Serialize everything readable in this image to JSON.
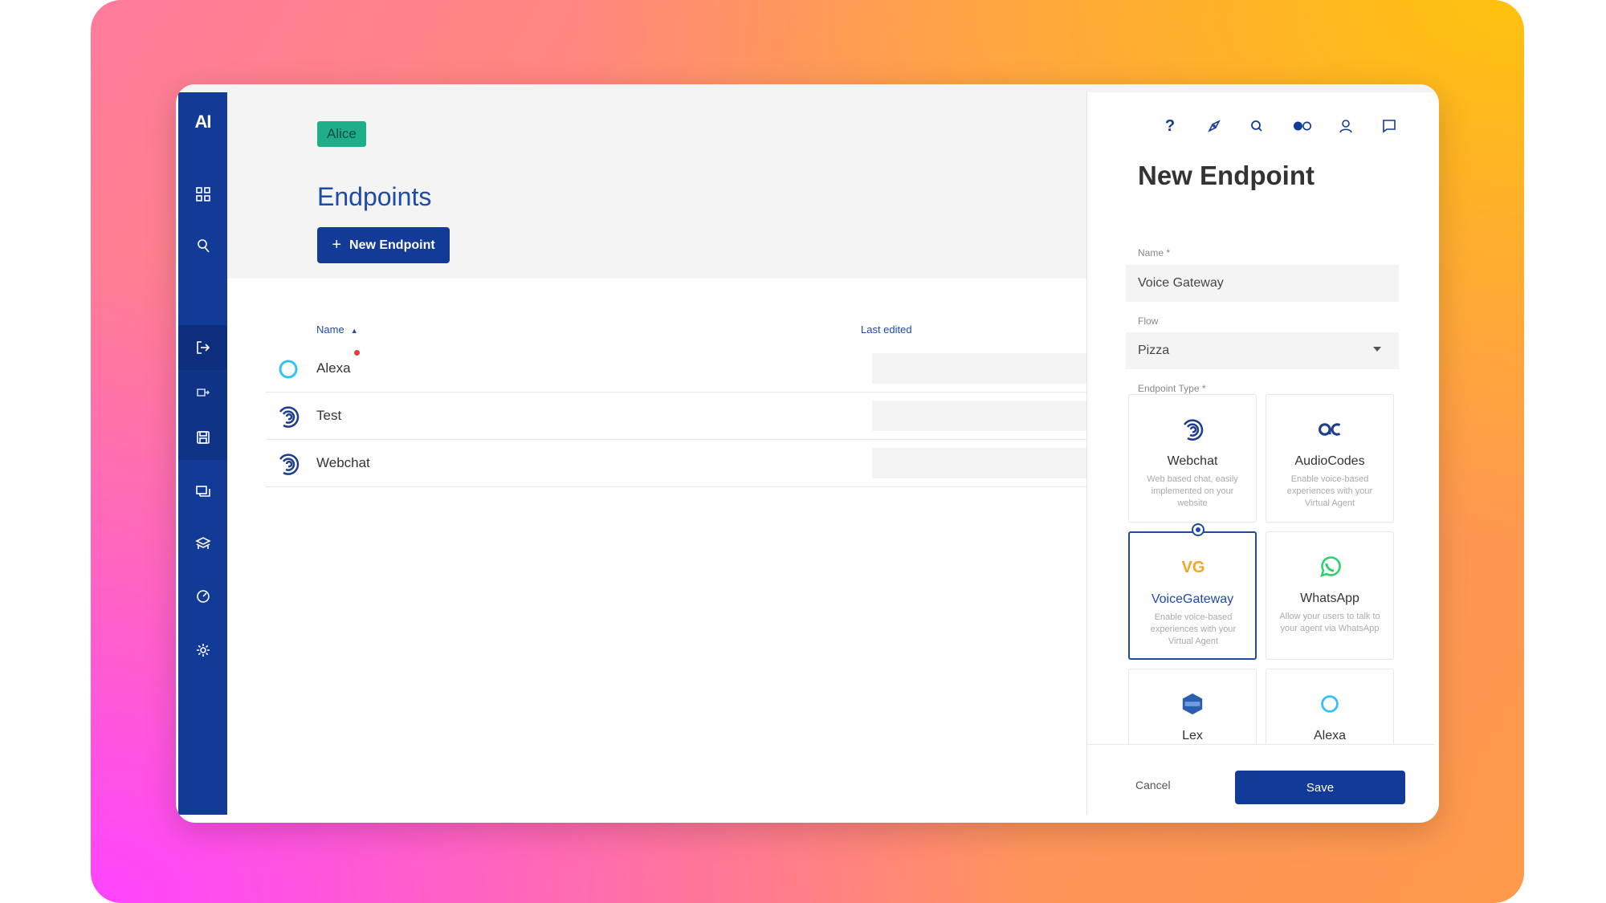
{
  "app": {
    "logo": "AI",
    "project_badge": "Alice"
  },
  "sidebar": {
    "items": [
      {
        "icon": "grid-icon"
      },
      {
        "icon": "pin-icon"
      },
      {
        "icon": "endpoint-icon",
        "active": true
      },
      {
        "icon": "sub-endpoint-icon"
      },
      {
        "icon": "save-icon"
      },
      {
        "icon": "chat-icon"
      },
      {
        "icon": "layers-icon"
      },
      {
        "icon": "analytics-icon"
      },
      {
        "icon": "settings-icon"
      }
    ]
  },
  "main": {
    "title": "Endpoints",
    "new_button_label": "New Endpoint",
    "table": {
      "columns": {
        "name": "Name",
        "last_edited": "Last edited"
      },
      "rows": [
        {
          "name": "Alexa",
          "icon": "alexa-icon",
          "notification": true
        },
        {
          "name": "Test",
          "icon": "webchat-icon"
        },
        {
          "name": "Webchat",
          "icon": "webchat-icon"
        }
      ]
    }
  },
  "panel": {
    "toolbar_icons": [
      "help-icon",
      "compass-icon",
      "search-icon",
      "toggle-icon",
      "user-icon",
      "chat-bubble-icon"
    ],
    "help_glyph": "?",
    "title": "New Endpoint",
    "name_label": "Name *",
    "name_value": "Voice Gateway",
    "flow_label": "Flow",
    "flow_value": "Pizza",
    "type_label": "Endpoint Type *",
    "types": [
      {
        "name": "Webchat",
        "desc": "Web based chat, easily implemented on your website"
      },
      {
        "name": "AudioCodes",
        "desc": "Enable voice-based experiences with your Virtual Agent"
      },
      {
        "name": "VoiceGateway",
        "desc": "Enable voice-based experiences with your Virtual Agent",
        "selected": true,
        "logo_text": "VG"
      },
      {
        "name": "WhatsApp",
        "desc": "Allow your users to talk to your agent via WhatsApp"
      },
      {
        "name": "Lex",
        "desc": ""
      },
      {
        "name": "Alexa",
        "desc": ""
      }
    ],
    "cancel_label": "Cancel",
    "save_label": "Save"
  },
  "colors": {
    "primary": "#123a97",
    "accent": "#1e4aa8",
    "badge": "#1fae8a",
    "voicegateway": "#f5a623",
    "whatsapp": "#25d366",
    "alexa": "#31c4f3"
  }
}
